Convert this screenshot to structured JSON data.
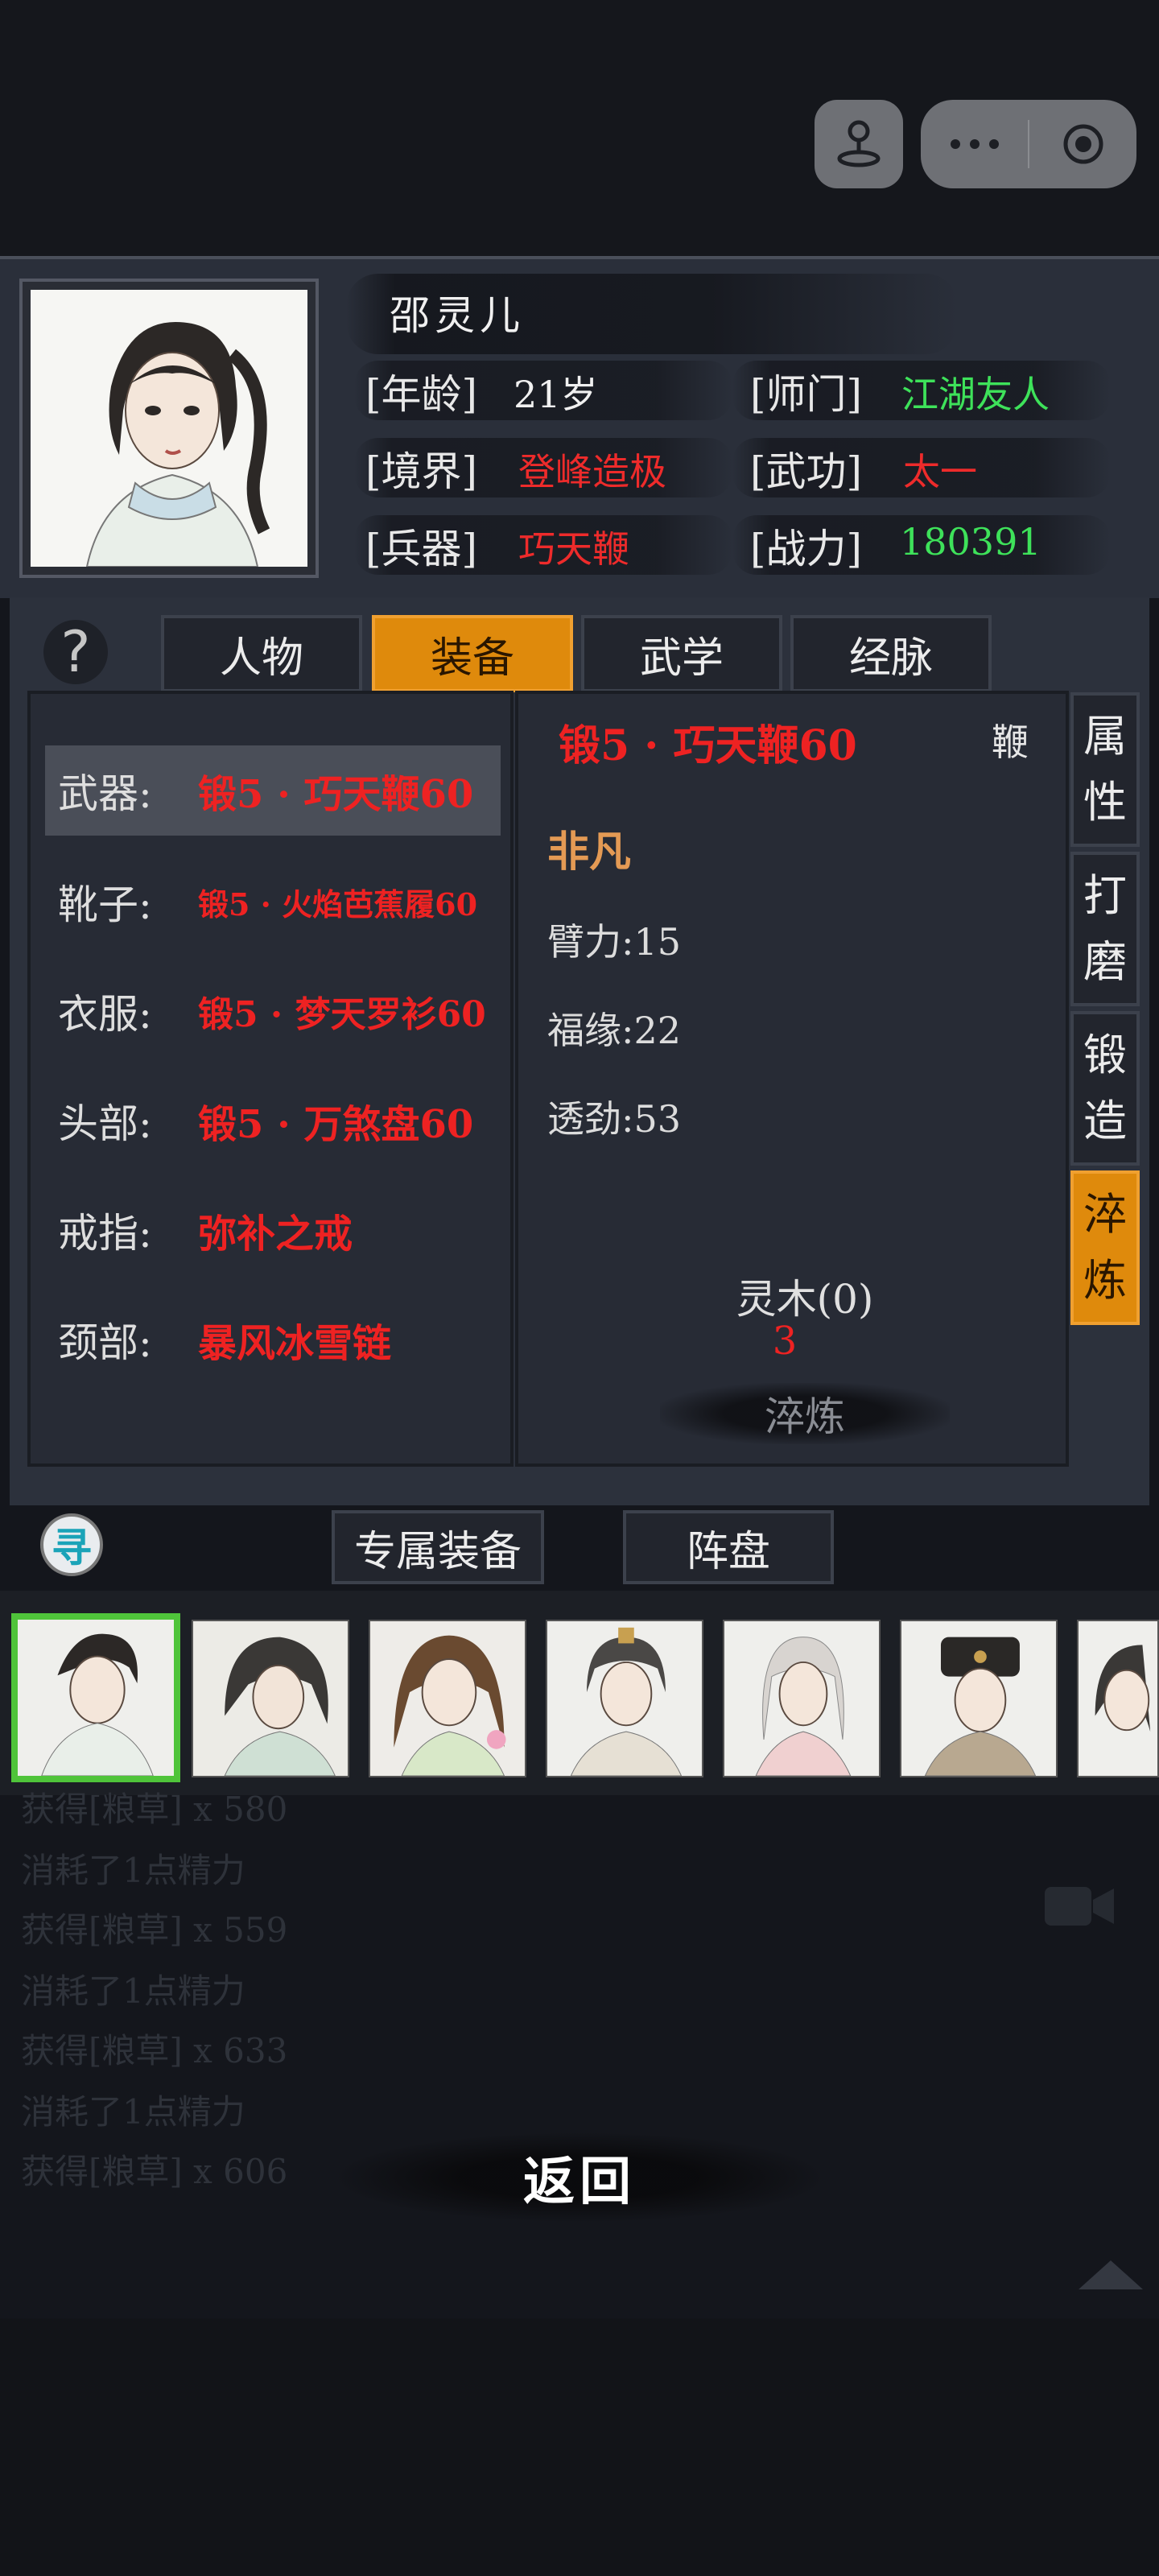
{
  "header": {
    "name": "邵灵儿",
    "stats": [
      {
        "label": "[年龄]",
        "value": "21岁",
        "color": "white"
      },
      {
        "label": "[师门]",
        "value": "江湖友人",
        "color": "green"
      },
      {
        "label": "[境界]",
        "value": "登峰造极",
        "color": "red"
      },
      {
        "label": "[武功]",
        "value": "太一",
        "color": "red"
      },
      {
        "label": "[兵器]",
        "value": "巧天鞭",
        "color": "red"
      },
      {
        "label": "[战力]",
        "value": "180391",
        "color": "green"
      }
    ]
  },
  "help_icon": "?",
  "tabs": [
    {
      "label": "人物",
      "active": false
    },
    {
      "label": "装备",
      "active": true
    },
    {
      "label": "武学",
      "active": false
    },
    {
      "label": "经脉",
      "active": false
    }
  ],
  "equipment": [
    {
      "label": "武器:",
      "value": "锻5 · 巧天鞭60",
      "selected": true
    },
    {
      "label": "靴子:",
      "value": "锻5 · 火焰芭蕉履60",
      "selected": false
    },
    {
      "label": "衣服:",
      "value": "锻5 · 梦天罗衫60",
      "selected": false
    },
    {
      "label": "头部:",
      "value": "锻5 · 万煞盘60",
      "selected": false
    },
    {
      "label": "戒指:",
      "value": "弥补之戒",
      "selected": false
    },
    {
      "label": "颈部:",
      "value": "暴风冰雪链",
      "selected": false
    }
  ],
  "detail": {
    "item_name": "锻5 · 巧天鞭60",
    "item_type": "鞭",
    "rarity": "非凡",
    "attributes": [
      "臂力:15",
      "福缘:22",
      "透劲:53"
    ],
    "material": "灵木(0)",
    "material_count": "3",
    "action_label": "淬炼"
  },
  "side_tabs": [
    {
      "chars": [
        "属",
        "性"
      ],
      "active": false
    },
    {
      "chars": [
        "打",
        "磨"
      ],
      "active": false
    },
    {
      "chars": [
        "锻",
        "造"
      ],
      "active": false
    },
    {
      "chars": [
        "淬",
        "炼"
      ],
      "active": true
    }
  ],
  "seek_icon": "寻",
  "sub_tabs": [
    "专属装备",
    "阵盘"
  ],
  "log": [
    "获得[粮草] x 580",
    "消耗了1点精力",
    "获得[粮草] x 559",
    "消耗了1点精力",
    "获得[粮草] x 633",
    "消耗了1点精力",
    "获得[粮草] x 606"
  ],
  "back_label": "返回",
  "colors": {
    "accent": "#df8a0c",
    "red": "#ee2222",
    "green": "#3ee25a",
    "rarity": "#e49a54"
  }
}
